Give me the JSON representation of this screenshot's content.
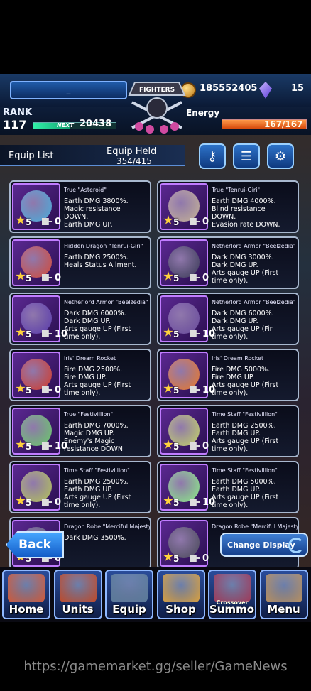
{
  "player": {
    "name": "_",
    "rank_label": "RANK",
    "rank": "117",
    "next_label": "NEXT",
    "next_exp": "20438",
    "rank_progress": 0.45
  },
  "currency": {
    "gold": "185552405",
    "crystals": "15"
  },
  "energy": {
    "label": "Energy",
    "value": "167/167",
    "fraction": 1.0
  },
  "logo_text": "FIGHTERS",
  "list_header": {
    "title": "Equip List",
    "held_label": "Equip Held",
    "held_value": "354/415"
  },
  "header_buttons": [
    {
      "name": "tag-filter-icon"
    },
    {
      "name": "sort-sliders-icon"
    },
    {
      "name": "settings-gear-icon"
    }
  ],
  "items": [
    {
      "name": "True \"Asteroid\"",
      "desc": "Earth DMG 3800%.\nMagic resistance\nDOWN.\nEarth DMG UP.",
      "stars": "5",
      "level": "0",
      "art": "#4ab0e0"
    },
    {
      "name": "True \"Tenrui-Giri\"",
      "desc": "Earth DMG 4000%.\nBlind resistance\nDOWN.\nEvasion rate DOWN.",
      "stars": "5",
      "level": "0",
      "art": "#c9b59a"
    },
    {
      "name": "Hidden Dragon \"Tenrui-Giri\"",
      "desc": "Earth DMG 2500%.\nHeals Status Ailment.",
      "stars": "5",
      "level": "0",
      "art": "#d84a3a"
    },
    {
      "name": "Netherlord Armor \"Beelzedia\"",
      "desc": "Dark DMG 3000%.\nDark DMG UP.\nArts gauge UP (First\ntime only).",
      "stars": "5",
      "level": "0",
      "art": "#3a3a58"
    },
    {
      "name": "Netherlord Armor \"Beelzedia\"",
      "desc": "Dark DMG 6000%.\nDark DMG UP.\nArts gauge UP (First\ntime only).",
      "stars": "5",
      "level": "10",
      "art": "#5a3ab0"
    },
    {
      "name": "Netherlord Armor \"Beelzedia\"",
      "desc": "Dark DMG 6000%.\nDark DMG UP.\nArts gauge UP (Fir\ntime only).",
      "stars": "5",
      "level": "10",
      "art": "#6a4aa0"
    },
    {
      "name": "Iris' Dream Rocket",
      "desc": "Fire DMG 2500%.\nFire DMG UP.\nArts gauge UP (First\ntime only).",
      "stars": "5",
      "level": "0",
      "art": "#d83a2a"
    },
    {
      "name": "Iris' Dream Rocket",
      "desc": "Fire DMG 5000%.\nFire DMG UP.\nArts gauge UP (First\ntime only).",
      "stars": "5",
      "level": "10",
      "art": "#f07a2a"
    },
    {
      "name": "True \"Festivillion\"",
      "desc": "Earth DMG 7000%.\nMagic DMG UP.\nEnemy's Magic\nresistance DOWN.",
      "stars": "5",
      "level": "10",
      "art": "#6ad06a"
    },
    {
      "name": "Time Staff \"Festivillion\"",
      "desc": "Earth DMG 2500%.\nEarth DMG UP.\nArts gauge UP (First\ntime only).",
      "stars": "5",
      "level": "0",
      "art": "#c8d86a"
    },
    {
      "name": "Time Staff \"Festivillion\"",
      "desc": "Earth DMG 2500%.\nEarth DMG UP.\nArts gauge UP (First\ntime only).",
      "stars": "5",
      "level": "0",
      "art": "#b8c85a"
    },
    {
      "name": "Time Staff \"Festivillion\"",
      "desc": "Earth DMG 5000%.\nEarth DMG UP.\nArts gauge UP (First\ntime only).",
      "stars": "5",
      "level": "10",
      "art": "#8ef08a"
    },
    {
      "name": "Dragon Robe \"Merciful Majesty\"",
      "desc": "Dark DMG 3500%.",
      "stars": "5",
      "level": "0",
      "art": "#5a5a7a"
    },
    {
      "name": "Dragon Robe \"Merciful Majesty\"",
      "desc": "",
      "stars": "5",
      "level": "0",
      "art": "#4a4a5a"
    }
  ],
  "buttons": {
    "back": "Back",
    "change_display": "Change Display"
  },
  "nav": [
    {
      "label": "Home",
      "sub": "",
      "color": "#d05a3a"
    },
    {
      "label": "Units",
      "sub": "",
      "color": "#c04a2a"
    },
    {
      "label": "Equip",
      "sub": "",
      "color": "#5a7a9a"
    },
    {
      "label": "Shop",
      "sub": "",
      "color": "#d8a040"
    },
    {
      "label": "Summon",
      "sub": "Crossover",
      "color": "#a03a5a"
    },
    {
      "label": "Menu",
      "sub": "",
      "color": "#b89060"
    }
  ],
  "watermark": "https://gamemarket.gg/seller/GameNews"
}
